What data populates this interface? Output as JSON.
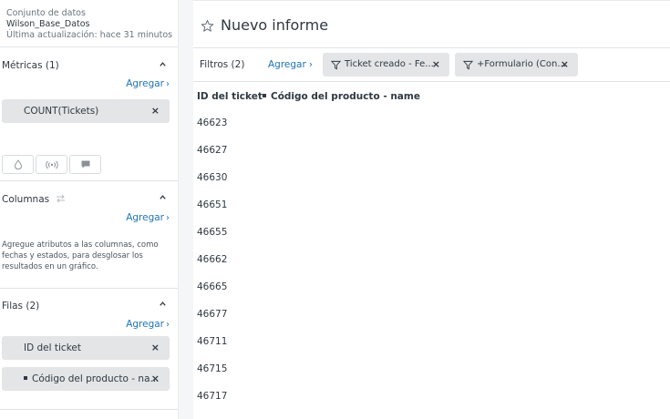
{
  "dataset": {
    "label": "Conjunto de datos",
    "name": "Wilson_Base_Datos",
    "updated": "Última actualización: hace 31 minutos"
  },
  "metrics": {
    "title": "Métricas (1)",
    "add_label": "Agregar",
    "items": [
      {
        "label": "COUNT(Tickets)"
      }
    ]
  },
  "columns": {
    "title": "Columnas",
    "add_label": "Agregar",
    "help": "Agregue atributos a las columnas, como fechas y estados, para desglosar los resultados en un gráfico."
  },
  "rows_section": {
    "title": "Filas (2)",
    "add_label": "Agregar",
    "items": [
      {
        "label": "ID del ticket"
      },
      {
        "label": "Código del producto - na..."
      }
    ]
  },
  "report": {
    "title": "Nuevo informe"
  },
  "filters": {
    "label": "Filtros (2)",
    "add_label": "Agregar",
    "chips": [
      {
        "label": "Ticket creado - Fe..."
      },
      {
        "label": "+Formulario (Con..."
      }
    ]
  },
  "table": {
    "headers": [
      "ID del ticket",
      "Código del producto - name"
    ],
    "rows": [
      "46623",
      "46627",
      "46630",
      "46651",
      "46655",
      "46662",
      "46665",
      "46677",
      "46711",
      "46715",
      "46717"
    ]
  },
  "colors": {
    "link": "#1f73b7",
    "pill": "#e3e5e7",
    "text": "#2f3941"
  }
}
